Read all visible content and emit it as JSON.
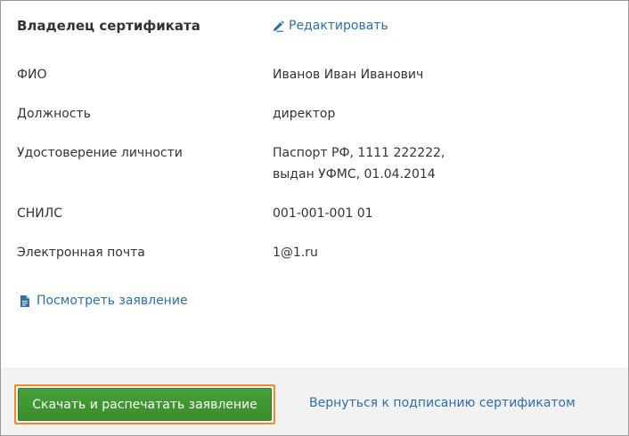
{
  "section": {
    "title": "Владелец сертификата",
    "edit_label": "Редактировать"
  },
  "fields": [
    {
      "label": "ФИО",
      "value": [
        "Иванов Иван Иванович"
      ]
    },
    {
      "label": "Должность",
      "value": [
        "директор"
      ]
    },
    {
      "label": "Удостоверение личности",
      "value": [
        "Паспорт РФ, 1111 222222,",
        "выдан УФМС, 01.04.2014"
      ]
    },
    {
      "label": "СНИЛС",
      "value": [
        "001-001-001 01"
      ]
    },
    {
      "label": "Электронная почта",
      "value": [
        "1@1.ru"
      ]
    }
  ],
  "view_statement_label": "Посмотреть заявление",
  "footer": {
    "download_button_label": "Скачать и распечатать заявление",
    "back_link_label": "Вернуться к подписанию сертификатом"
  },
  "colors": {
    "link": "#2b6fad",
    "primary_button": "#3f962f",
    "focus_outline": "#f08a2c",
    "footer_background": "#f2f2f2"
  },
  "icons": {
    "edit": "pencil-icon",
    "view_statement": "document-icon"
  }
}
